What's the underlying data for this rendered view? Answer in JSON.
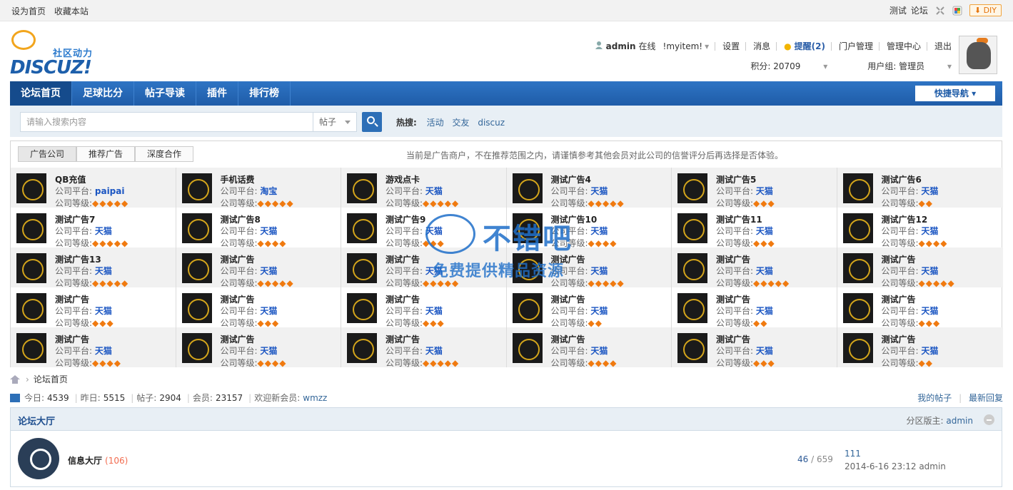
{
  "topbar": {
    "left_links": [
      "设为首页",
      "收藏本站"
    ],
    "right_links": [
      "测试",
      "论坛"
    ],
    "diy_label": "DIY",
    "icons": [
      "collapse-icon",
      "color-icon"
    ]
  },
  "logo": {
    "slogan": "社区动力",
    "brand": "DISCUZ!"
  },
  "user": {
    "name": "admin",
    "status": "在线",
    "myitem": "!myitem!",
    "links": [
      "设置",
      "消息"
    ],
    "remind": "提醒(2)",
    "links2": [
      "门户管理",
      "管理中心",
      "退出"
    ],
    "score_label": "积分: 20709",
    "group_label": "用户组: 管理员"
  },
  "nav": {
    "items": [
      "论坛首页",
      "足球比分",
      "帖子导读",
      "插件",
      "排行榜"
    ],
    "active_index": 0,
    "quick_nav": "快捷导航"
  },
  "search": {
    "placeholder": "请输入搜索内容",
    "scope": "帖子",
    "hot_label": "热搜:",
    "hot_keywords": [
      "活动",
      "交友",
      "discuz"
    ]
  },
  "ads": {
    "tabs": [
      "广告公司",
      "推荐广告",
      "深度合作"
    ],
    "notice": "当前是广告商户，不在推荐范围之内，请谨慎参考其他会员对此公司的信誉评分后再选择是否体验。",
    "platform_label": "公司平台:",
    "level_label": "公司等级:",
    "rows": [
      [
        {
          "name": "QB充值",
          "platform": "paipai",
          "level": 5
        },
        {
          "name": "手机话费",
          "platform": "淘宝",
          "level": 5
        },
        {
          "name": "游戏点卡",
          "platform": "天猫",
          "level": 5
        },
        {
          "name": "测试广告4",
          "platform": "天猫",
          "level": 5
        },
        {
          "name": "测试广告5",
          "platform": "天猫",
          "level": 3
        },
        {
          "name": "测试广告6",
          "platform": "天猫",
          "level": 2
        }
      ],
      [
        {
          "name": "测试广告7",
          "platform": "天猫",
          "level": 5
        },
        {
          "name": "测试广告8",
          "platform": "天猫",
          "level": 4
        },
        {
          "name": "测试广告9",
          "platform": "天猫",
          "level": 3
        },
        {
          "name": "测试广告10",
          "platform": "天猫",
          "level": 4
        },
        {
          "name": "测试广告11",
          "platform": "天猫",
          "level": 3
        },
        {
          "name": "测试广告12",
          "platform": "天猫",
          "level": 4
        }
      ],
      [
        {
          "name": "测试广告13",
          "platform": "天猫",
          "level": 5
        },
        {
          "name": "测试广告",
          "platform": "天猫",
          "level": 5
        },
        {
          "name": "测试广告",
          "platform": "天猫",
          "level": 5
        },
        {
          "name": "测试广告",
          "platform": "天猫",
          "level": 5
        },
        {
          "name": "测试广告",
          "platform": "天猫",
          "level": 5
        },
        {
          "name": "测试广告",
          "platform": "天猫",
          "level": 5
        }
      ],
      [
        {
          "name": "测试广告",
          "platform": "天猫",
          "level": 3
        },
        {
          "name": "测试广告",
          "platform": "天猫",
          "level": 3
        },
        {
          "name": "测试广告",
          "platform": "天猫",
          "level": 3
        },
        {
          "name": "测试广告",
          "platform": "天猫",
          "level": 2
        },
        {
          "name": "测试广告",
          "platform": "天猫",
          "level": 2
        },
        {
          "name": "测试广告",
          "platform": "天猫",
          "level": 3
        }
      ],
      [
        {
          "name": "测试广告",
          "platform": "天猫",
          "level": 4
        },
        {
          "name": "测试广告",
          "platform": "天猫",
          "level": 4
        },
        {
          "name": "测试广告",
          "platform": "天猫",
          "level": 5
        },
        {
          "name": "测试广告",
          "platform": "天猫",
          "level": 4
        },
        {
          "name": "测试广告",
          "platform": "天猫",
          "level": 3
        },
        {
          "name": "测试广告",
          "platform": "天猫",
          "level": 2
        }
      ]
    ]
  },
  "watermark": {
    "title": "不错吧",
    "subtitle": "免费提供精品资源"
  },
  "breadcrumb": {
    "current": "论坛首页"
  },
  "stats": {
    "today": "今日: ",
    "today_val": "4539",
    "yesterday": "昨日: ",
    "yesterday_val": "5515",
    "posts": "帖子: ",
    "posts_val": "2904",
    "members": "会员: ",
    "members_val": "23157",
    "welcome": "欢迎新会员: ",
    "new_member": "wmzz",
    "my_posts": "我的帖子",
    "latest_reply": "最新回复"
  },
  "forum": {
    "category": "论坛大厅",
    "moderator_label": "分区版主: ",
    "moderator": "admin",
    "board_name": "信息大厅",
    "board_count": "(106)",
    "threads": "46",
    "posts": " / 659",
    "last_title": "111",
    "last_info": "2014-6-16 23:12 admin"
  }
}
